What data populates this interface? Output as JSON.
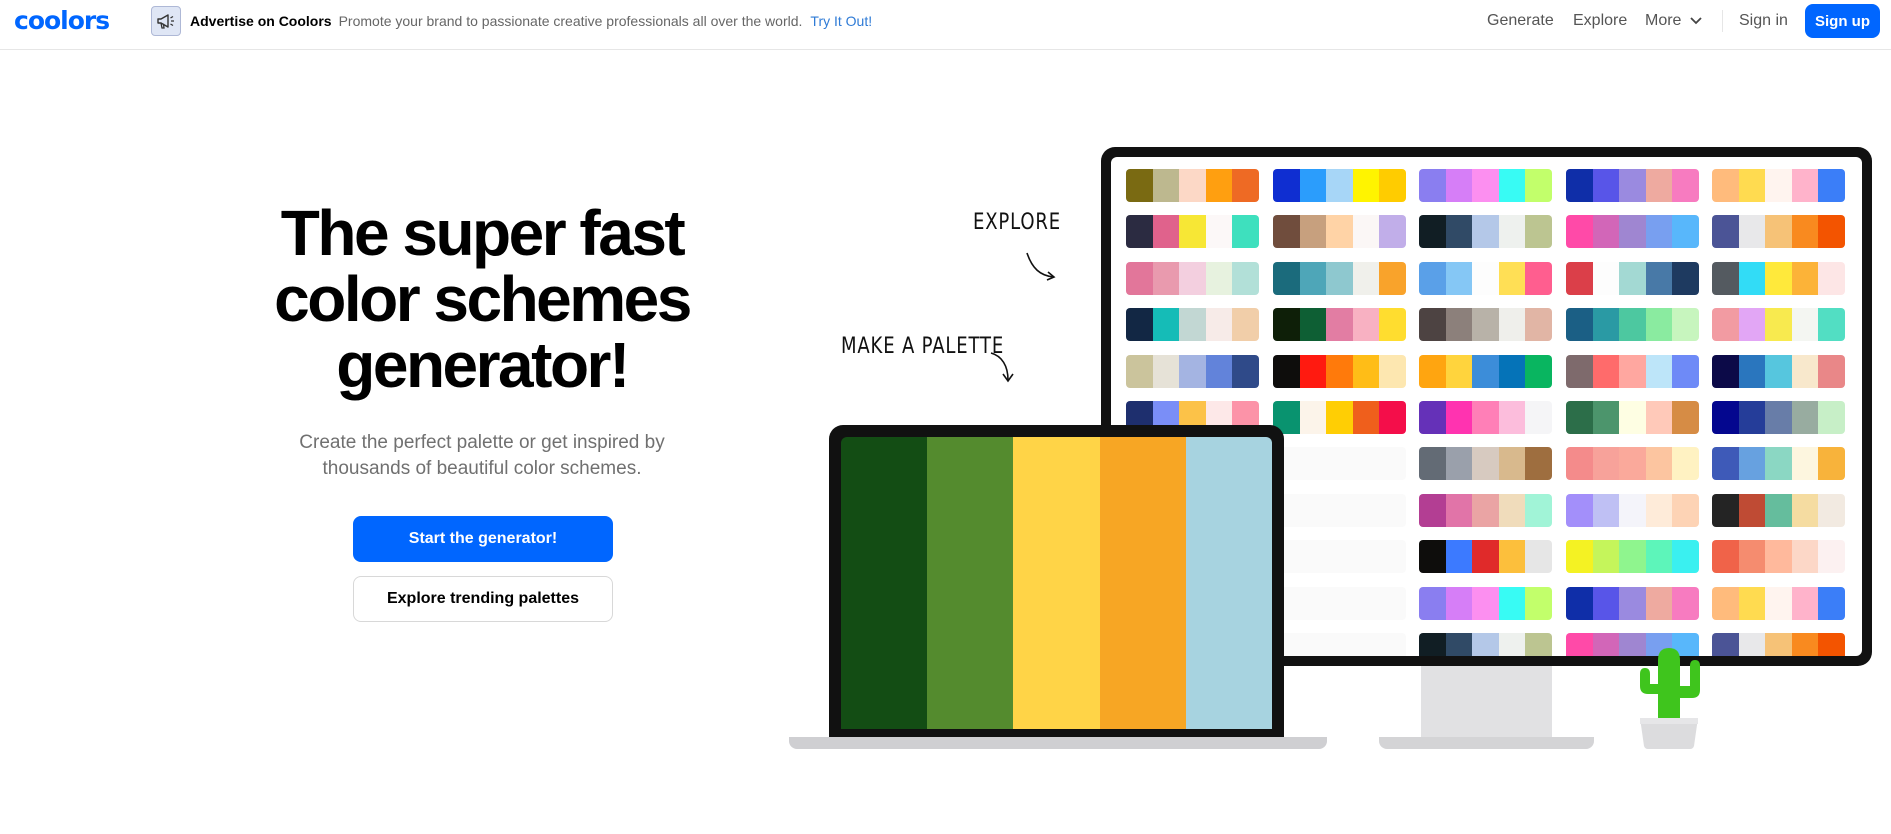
{
  "header": {
    "logo": "coolors",
    "ad": {
      "icon": "megaphone-icon",
      "title": "Advertise on Coolors",
      "text": "Promote your brand to passionate creative professionals all over the world.",
      "link": "Try It Out!"
    },
    "nav": {
      "generate": "Generate",
      "explore": "Explore",
      "more": "More",
      "sign_in": "Sign in",
      "sign_up": "Sign up"
    }
  },
  "hero": {
    "title_line1": "The super fast",
    "title_line2": "color schemes",
    "title_line3": "generator!",
    "subtitle_line1": "Create the perfect palette or get inspired by",
    "subtitle_line2": "thousands of beautiful color schemes.",
    "primary_button": "Start the generator!",
    "secondary_button": "Explore trending palettes"
  },
  "illustration": {
    "note_explore": "EXPLORE",
    "note_make_palette": "MAKE A PALETTE",
    "laptop_palette": [
      "#134d14",
      "#548b2e",
      "#ffd447",
      "#f7a624",
      "#a7d3e0"
    ],
    "monitor_palettes": [
      [
        [
          "#7a6a12",
          "#bdb88f",
          "#fcd8c6",
          "#ff9f10",
          "#ee6a24"
        ],
        [
          "#0f2ed1",
          "#2b9dfc",
          "#a7d6f7",
          "#fff400",
          "#ffcc00"
        ],
        [
          "#8a7ef0",
          "#d67ef7",
          "#fc8ff0",
          "#38fbf4",
          "#c2ff6b"
        ],
        [
          "#0f2ea8",
          "#5855e8",
          "#9a8ae0",
          "#eeaaa0",
          "#f77bc0"
        ],
        [
          "#ffbb7c",
          "#ffdb50",
          "#fff4ef",
          "#ffb3cb",
          "#3b7ef8"
        ]
      ],
      [
        [
          "#2b2b41",
          "#e0628c",
          "#f7e735",
          "#fcf8f8",
          "#3ee0be"
        ],
        [
          "#704d3d",
          "#c7a07e",
          "#ffd3a6",
          "#fbf7f6",
          "#c1aee9"
        ],
        [
          "#111e24",
          "#304a66",
          "#b4c8e8",
          "#eef1ee",
          "#bcc591"
        ],
        [
          "#ff4aa8",
          "#d266b8",
          "#9f86d1",
          "#789ff0",
          "#58b7fb"
        ],
        [
          "#4b5496",
          "#e8e8ea",
          "#f6c277",
          "#f98a1f",
          "#f35400"
        ]
      ],
      [
        [
          "#e2769a",
          "#e99aae",
          "#f3cfdf",
          "#e7f2df",
          "#b2e0d8"
        ],
        [
          "#1b6b7c",
          "#4ea6b8",
          "#8ec8cf",
          "#f0f0eb",
          "#f9a32b"
        ],
        [
          "#5aa0e8",
          "#85c7f5",
          "#fdfdfd",
          "#ffdf55",
          "#ff5e8f"
        ],
        [
          "#db3f49",
          "#fdfdfd",
          "#a3d9d3",
          "#4879a7",
          "#1e3a60"
        ],
        [
          "#545a60",
          "#32dcf6",
          "#ffe93b",
          "#fcb338",
          "#fde6e6"
        ]
      ],
      [
        [
          "#122744",
          "#15bcb7",
          "#c2d7d3",
          "#f7ebe8",
          "#f1cea9"
        ],
        [
          "#0e1f08",
          "#0e5f34",
          "#e27da3",
          "#f8b1c2",
          "#ffdd2f"
        ],
        [
          "#4d4342",
          "#8c807b",
          "#b8b2a8",
          "#efefeb",
          "#e1b5a5"
        ],
        [
          "#1b5f85",
          "#2a9aa4",
          "#4dc8a0",
          "#8aeba0",
          "#c7f5be"
        ],
        [
          "#f29ba2",
          "#e2a6f5",
          "#f8ea4f",
          "#f4f6f2",
          "#52dec3"
        ]
      ],
      [
        [
          "#cbc49c",
          "#e6e2d7",
          "#a4b4e2",
          "#6283da",
          "#2f4a89"
        ],
        [
          "#0e0d0c",
          "#ff1a10",
          "#ff7a0b",
          "#ffbd17",
          "#fde7b0"
        ],
        [
          "#ffa510",
          "#ffd43d",
          "#3c8dd9",
          "#0573b8",
          "#09b560"
        ],
        [
          "#7e6a6c",
          "#ff6b6b",
          "#ffa7a0",
          "#bde5f9",
          "#6e8af7"
        ],
        [
          "#0c0a48",
          "#2a76be",
          "#56c6de",
          "#f8e8cc",
          "#e98788"
        ]
      ],
      [
        [
          "#1e2f6e",
          "#7a8ef7",
          "#fcc248",
          "#fde8e8",
          "#fc93a8"
        ],
        [
          "#09936f",
          "#fcf4ea",
          "#ffce04",
          "#ef5f1c",
          "#f40e4a"
        ],
        [
          "#6531b8",
          "#ff33b0",
          "#ff7fb7",
          "#fcbddc",
          "#f5f5f7"
        ],
        [
          "#2c6e49",
          "#4c956c",
          "#fefee3",
          "#ffc9b9",
          "#d68c45"
        ],
        [
          "#04078f",
          "#253d99",
          "#687da8",
          "#98aca0",
          "#c7efc7"
        ]
      ],
      [
        [
          "#5e6472",
          "#a39fc1",
          "#ebe8f4",
          "#d3f4ef",
          "#d8c895"
        ],
        [
          "#fafafa",
          "#fafafa",
          "#fafafa",
          "#fafafa",
          "#fafafa"
        ],
        [
          "#636b75",
          "#9aa0ab",
          "#d7cac0",
          "#d8b98d",
          "#9e6e3f"
        ],
        [
          "#f48b8b",
          "#f7a29a",
          "#faa99b",
          "#fcc5a0",
          "#fff2c2"
        ],
        [
          "#3e5ab8",
          "#67a1e0",
          "#8bd7c3",
          "#fdf6df",
          "#f8b33b"
        ]
      ],
      [
        [
          "#ff7c7c",
          "#e8a0a0",
          "#d3b8b8",
          "#b7d6d8",
          "#9cf7f7"
        ],
        [
          "#fafafa",
          "#fafafa",
          "#fafafa",
          "#fafafa",
          "#fafafa"
        ],
        [
          "#b33e93",
          "#e174a8",
          "#eaa4a4",
          "#f0dcbb",
          "#a1f4d7"
        ],
        [
          "#a38ffa",
          "#bfc0f4",
          "#f4f4fa",
          "#feebd9",
          "#fdd3b5"
        ],
        [
          "#242424",
          "#bf4b34",
          "#65bd9d",
          "#f5dca1",
          "#f2eae1"
        ]
      ],
      [
        [
          "#5eb7ed",
          "#fda725",
          "#fbd144",
          "#538d2a",
          "#134c13"
        ],
        [
          "#fafafa",
          "#fafafa",
          "#fafafa",
          "#fafafa",
          "#fafafa"
        ],
        [
          "#0e0d0c",
          "#3c7aff",
          "#e02a2a",
          "#fcbf3c",
          "#e6e6e6"
        ],
        [
          "#f4f223",
          "#c5f55b",
          "#8ff58e",
          "#5df5ba",
          "#3af0f0"
        ],
        [
          "#f06349",
          "#f58c6f",
          "#ffb99c",
          "#fcd7c7",
          "#fcf1f1"
        ]
      ],
      [
        [
          "#0f2ed1",
          "#2b9dfc",
          "#a7d6f7",
          "#fff400",
          "#ffcc00"
        ],
        [
          "#fafafa",
          "#fafafa",
          "#fafafa",
          "#fafafa",
          "#fafafa"
        ],
        [
          "#8a7ef0",
          "#d67ef7",
          "#fc8ff0",
          "#38fbf4",
          "#c2ff6b"
        ],
        [
          "#0f2ea8",
          "#5855e8",
          "#9a8ae0",
          "#eeaaa0",
          "#f77bc0"
        ],
        [
          "#ffbb7c",
          "#ffdb50",
          "#fff4ef",
          "#ffb3cb",
          "#3b7ef8"
        ]
      ],
      [
        [
          "#704d3d",
          "#c7a07e",
          "#ffd3a6",
          "#fbf7f6",
          "#c1aee9"
        ],
        [
          "#fafafa",
          "#fafafa",
          "#fafafa",
          "#fafafa",
          "#fafafa"
        ],
        [
          "#111e24",
          "#304a66",
          "#b4c8e8",
          "#eef1ee",
          "#bcc591"
        ],
        [
          "#ff4aa8",
          "#d266b8",
          "#9f86d1",
          "#789ff0",
          "#58b7fb"
        ],
        [
          "#4b5496",
          "#e8e8ea",
          "#f6c277",
          "#f98a1f",
          "#f35400"
        ]
      ]
    ]
  }
}
